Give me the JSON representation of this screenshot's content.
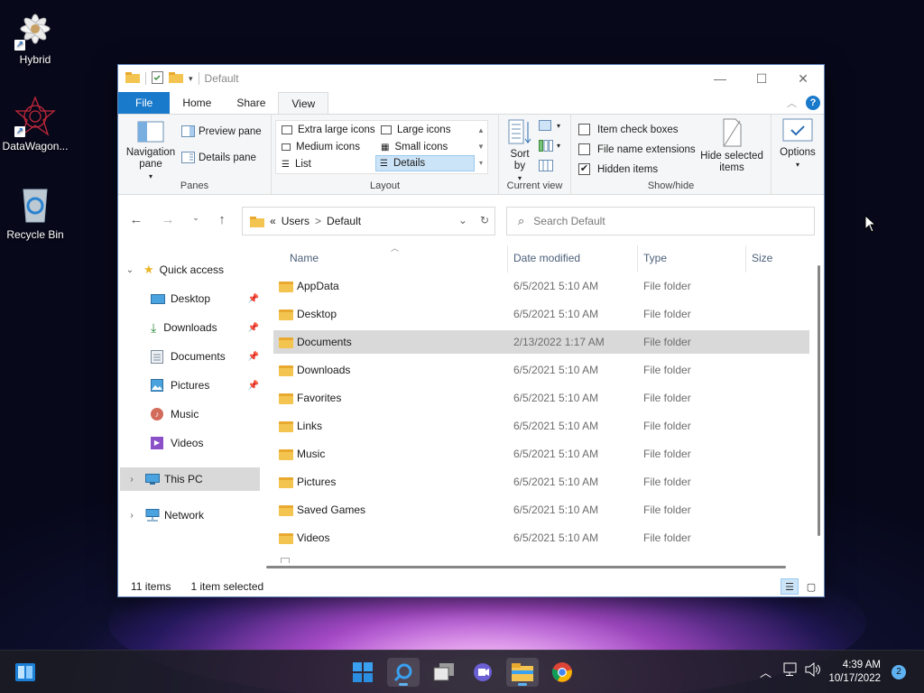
{
  "desktop": {
    "icons": [
      {
        "label": "Hybrid",
        "icon": "hybrid-app-icon"
      },
      {
        "label": "DataWagon...",
        "icon": "datawagon-app-icon"
      },
      {
        "label": "Recycle Bin",
        "icon": "recycle-bin-icon"
      }
    ]
  },
  "window": {
    "title": "Default",
    "controls": {
      "minimize": "—",
      "maximize": "☐",
      "close": "✕"
    },
    "ribbon_tabs": [
      "File",
      "Home",
      "Share",
      "View"
    ],
    "active_tab": "View",
    "ribbon": {
      "panes": {
        "navigation_pane": "Navigation pane",
        "preview_pane": "Preview pane",
        "details_pane": "Details pane",
        "label": "Panes"
      },
      "layout": {
        "items": [
          "Extra large icons",
          "Large icons",
          "Medium icons",
          "Small icons",
          "List",
          "Details"
        ],
        "selected": "Details",
        "label": "Layout"
      },
      "current_view": {
        "sort_by": "Sort by",
        "label": "Current view"
      },
      "show_hide": {
        "item_check_boxes": "Item check boxes",
        "item_check_boxes_checked": false,
        "file_name_extensions": "File name extensions",
        "file_name_extensions_checked": false,
        "hidden_items": "Hidden items",
        "hidden_items_checked": true,
        "hide_selected_items": "Hide selected items",
        "label": "Show/hide"
      },
      "options": "Options"
    },
    "address": {
      "prefix": "«",
      "crumbs": [
        "Users",
        "Default"
      ],
      "separator": ">"
    },
    "search": {
      "placeholder": "Search Default"
    },
    "nav_pane": {
      "quick_access": "Quick access",
      "quick_items": [
        {
          "label": "Desktop",
          "icon": "desktop-folder-icon",
          "pinned": true
        },
        {
          "label": "Downloads",
          "icon": "downloads-icon",
          "pinned": true
        },
        {
          "label": "Documents",
          "icon": "documents-icon",
          "pinned": true
        },
        {
          "label": "Pictures",
          "icon": "pictures-icon",
          "pinned": true
        },
        {
          "label": "Music",
          "icon": "music-icon",
          "pinned": false
        },
        {
          "label": "Videos",
          "icon": "videos-icon",
          "pinned": false
        }
      ],
      "this_pc": "This PC",
      "network": "Network"
    },
    "columns": [
      "Name",
      "Date modified",
      "Type",
      "Size"
    ],
    "files": [
      {
        "name": "AppData",
        "date": "6/5/2021 5:10 AM",
        "type": "File folder",
        "selected": false
      },
      {
        "name": "Desktop",
        "date": "6/5/2021 5:10 AM",
        "type": "File folder",
        "selected": false
      },
      {
        "name": "Documents",
        "date": "2/13/2022 1:17 AM",
        "type": "File folder",
        "selected": true
      },
      {
        "name": "Downloads",
        "date": "6/5/2021 5:10 AM",
        "type": "File folder",
        "selected": false
      },
      {
        "name": "Favorites",
        "date": "6/5/2021 5:10 AM",
        "type": "File folder",
        "selected": false
      },
      {
        "name": "Links",
        "date": "6/5/2021 5:10 AM",
        "type": "File folder",
        "selected": false
      },
      {
        "name": "Music",
        "date": "6/5/2021 5:10 AM",
        "type": "File folder",
        "selected": false
      },
      {
        "name": "Pictures",
        "date": "6/5/2021 5:10 AM",
        "type": "File folder",
        "selected": false
      },
      {
        "name": "Saved Games",
        "date": "6/5/2021 5:10 AM",
        "type": "File folder",
        "selected": false
      },
      {
        "name": "Videos",
        "date": "6/5/2021 5:10 AM",
        "type": "File folder",
        "selected": false
      }
    ],
    "status": {
      "item_count": "11 items",
      "selection": "1 item selected"
    }
  },
  "taskbar": {
    "apps": [
      "widgets-icon",
      "start-icon",
      "search-icon",
      "task-view-icon",
      "teams-chat-icon",
      "file-explorer-icon",
      "chrome-icon"
    ],
    "time": "4:39 AM",
    "date": "10/17/2022",
    "notification_count": "2"
  },
  "colors": {
    "accent": "#1979ca",
    "selection": "#d9d9d9",
    "folder": "#f4c451"
  }
}
